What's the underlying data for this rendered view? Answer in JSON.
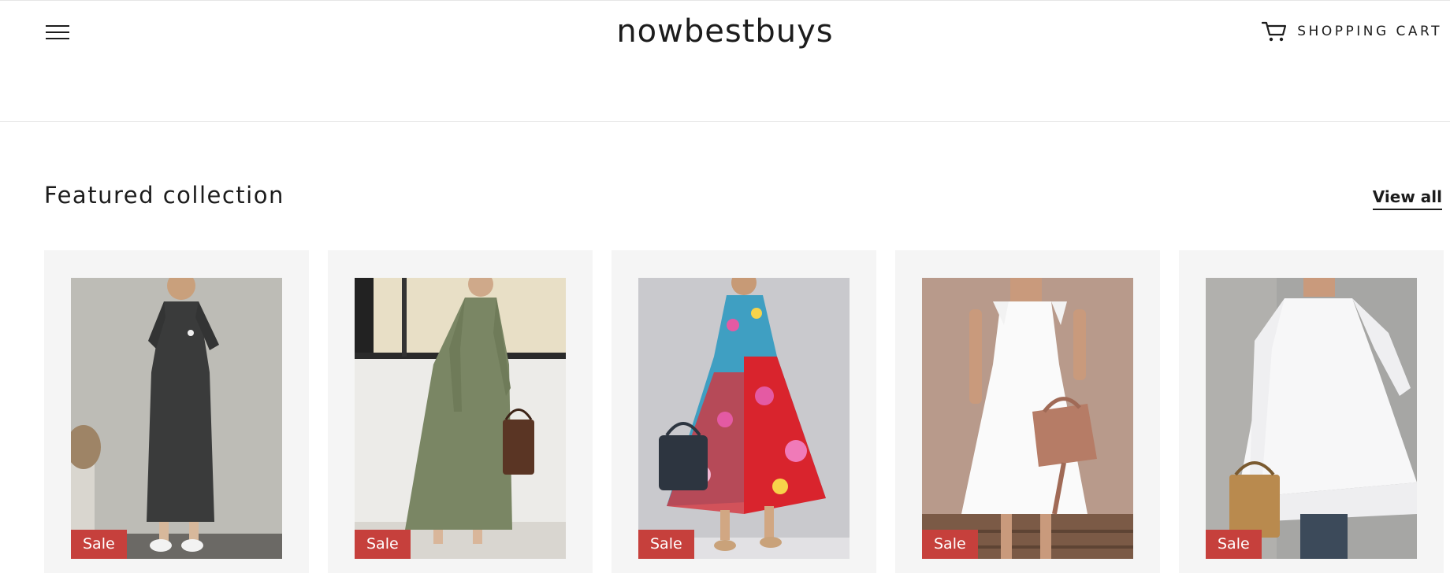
{
  "header": {
    "logo_text": "nowbestbuys",
    "cart_label": "SHOPPING CART"
  },
  "section": {
    "title": "Featured collection",
    "view_all_label": "View all"
  },
  "products": [
    {
      "badge": "Sale"
    },
    {
      "badge": "Sale"
    },
    {
      "badge": "Sale"
    },
    {
      "badge": "Sale"
    },
    {
      "badge": "Sale"
    }
  ]
}
